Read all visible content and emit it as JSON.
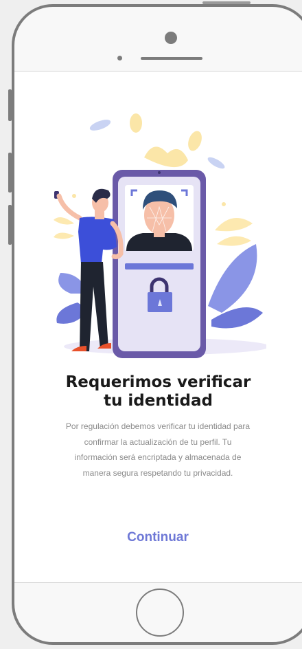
{
  "screen": {
    "title_line1": "Requerimos verificar",
    "title_line2": "tu identidad",
    "description_lines": [
      "Por regulación debemos verificar tu identidad para",
      "confirmar la actualización de tu perfil.  Tu",
      "información será encriptada y almacenada de",
      "manera segura respetando tu privacidad."
    ],
    "continue_label": "Continuar"
  },
  "illustration": {
    "icons": [
      "face-scan-icon",
      "lock-icon",
      "person-with-key-fob",
      "leaf-decoration"
    ]
  },
  "colors": {
    "accent": "#6e78d6",
    "title": "#1a1a1a",
    "body_text": "#8a8a8a",
    "frame": "#7c7c7c",
    "device_purple": "#6a5aa8",
    "device_screen": "#e6e3f5",
    "face_bg": "#2f4f7a",
    "shirt_blue": "#3c4fd9",
    "leaf_blue": "#8a95e6",
    "blob_yellow": "#fbe6a8"
  }
}
